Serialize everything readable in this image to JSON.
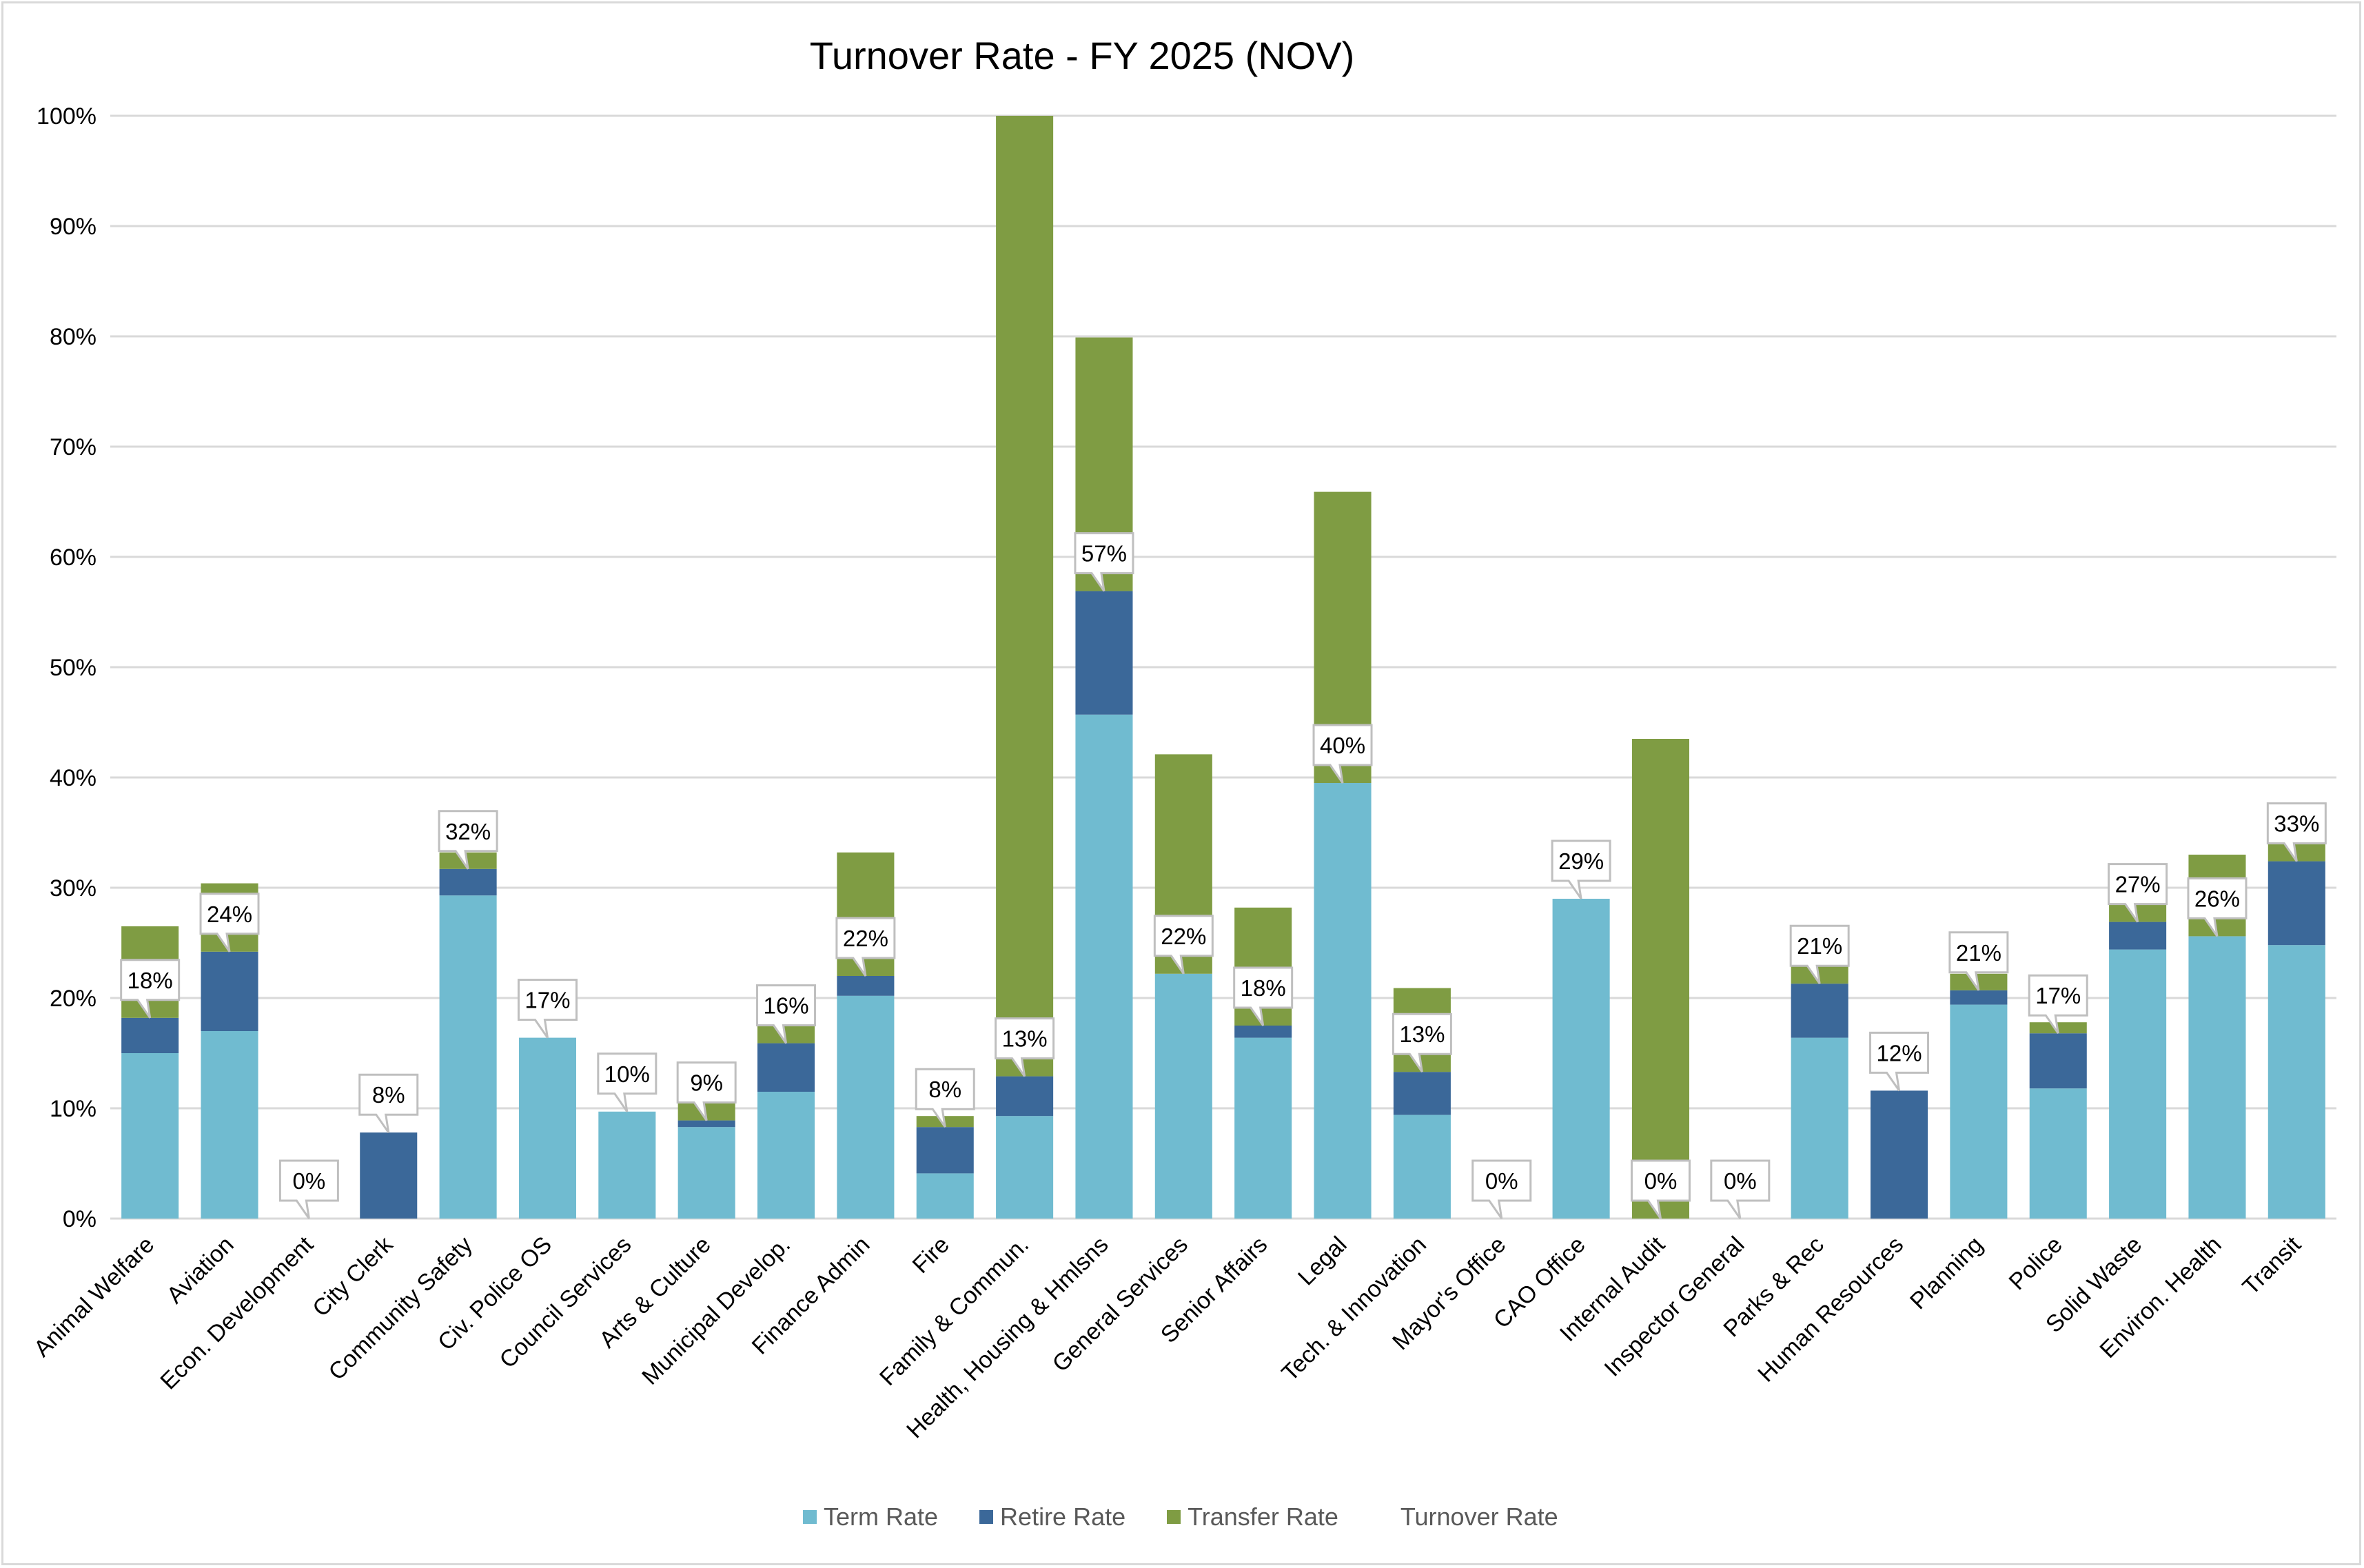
{
  "chart_data": {
    "type": "bar",
    "stacked": true,
    "title": "Turnover Rate - FY 2025 (NOV)",
    "xlabel": "",
    "ylabel": "",
    "ylim": [
      0,
      100
    ],
    "yticks": [
      "0%",
      "10%",
      "20%",
      "30%",
      "40%",
      "50%",
      "60%",
      "70%",
      "80%",
      "90%",
      "100%"
    ],
    "grid": true,
    "legend_position": "bottom",
    "categories": [
      "Animal Welfare",
      "Aviation",
      "Econ. Development",
      "City Clerk",
      "Community Safety",
      "Civ. Police OS",
      "Council Services",
      "Arts & Culture",
      "Municipal Develop.",
      "Finance Admin",
      "Fire",
      "Family & Commun.",
      "Health, Housing & Hmlsns",
      "General Services",
      "Senior Affairs",
      "Legal",
      "Tech. & Innovation",
      "Mayor's Office",
      "CAO Office",
      "Internal Audit",
      "Inspector General",
      "Parks & Rec",
      "Human Resources",
      "Planning",
      "Police",
      "Solid Waste",
      "Environ. Health",
      "Transit"
    ],
    "series": [
      {
        "name": "Term Rate",
        "color": "#70bbd0",
        "values": [
          15.0,
          17.0,
          0,
          0,
          29.3,
          16.4,
          9.7,
          8.3,
          11.5,
          20.2,
          4.1,
          9.3,
          45.7,
          22.2,
          16.4,
          39.5,
          9.4,
          0,
          29.0,
          0,
          0,
          16.4,
          0,
          19.4,
          11.8,
          24.4,
          25.6,
          24.8
        ]
      },
      {
        "name": "Retire Rate",
        "color": "#3b6899",
        "values": [
          3.2,
          7.2,
          0,
          7.8,
          2.4,
          0,
          0,
          0.6,
          4.4,
          1.8,
          4.2,
          3.6,
          11.2,
          0,
          1.1,
          0,
          3.9,
          0,
          0,
          0,
          0,
          4.9,
          11.6,
          1.3,
          5.0,
          2.5,
          0,
          7.6
        ]
      },
      {
        "name": "Transfer Rate",
        "color": "#7f9c43",
        "values": [
          8.3,
          6.2,
          0,
          0,
          1.5,
          0,
          0,
          1.6,
          1.7,
          11.2,
          1.0,
          87.1,
          23.0,
          19.9,
          10.7,
          26.4,
          7.6,
          0,
          0,
          43.5,
          0,
          1.7,
          0,
          1.5,
          1.0,
          1.7,
          7.4,
          1.7
        ]
      }
    ],
    "turnover_labels": [
      "18%",
      "24%",
      "0%",
      "8%",
      "32%",
      "17%",
      "10%",
      "9%",
      "16%",
      "22%",
      "8%",
      "13%",
      "57%",
      "22%",
      "18%",
      "40%",
      "13%",
      "0%",
      "29%",
      "0%",
      "0%",
      "21%",
      "12%",
      "21%",
      "17%",
      "27%",
      "26%",
      "33%"
    ],
    "turnover_series_name": "Turnover Rate"
  },
  "colors": {
    "gridline": "#d9d9d9",
    "callout_border": "#bfbfbf",
    "legend_text": "#595959"
  }
}
